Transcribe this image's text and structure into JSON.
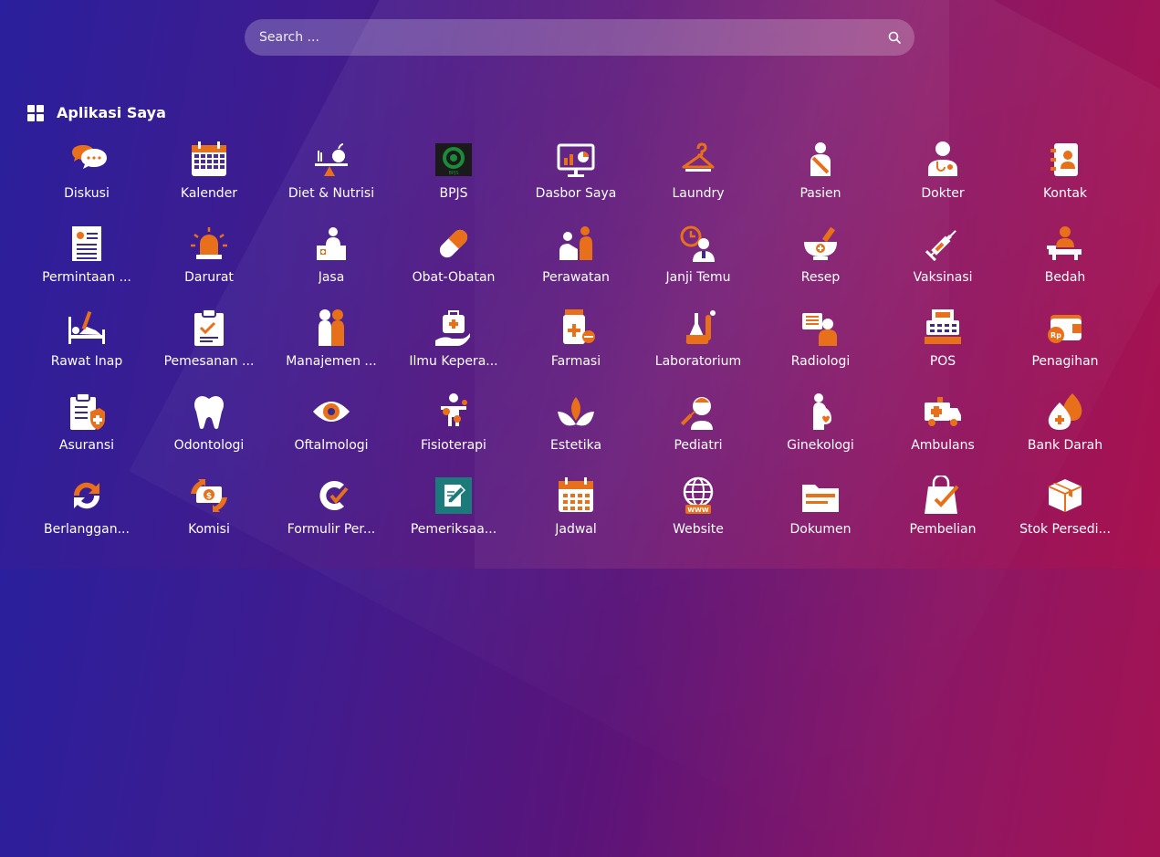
{
  "search": {
    "placeholder": "Search ..."
  },
  "section": {
    "title": "Aplikasi Saya",
    "icon": "grid-icon"
  },
  "colors": {
    "accent": "#e8701a",
    "icon_white": "#ffffff"
  },
  "apps": [
    {
      "label": "Diskusi",
      "icon": "chat-bubbles-icon"
    },
    {
      "label": "Kalender",
      "icon": "calendar-icon"
    },
    {
      "label": "Diet & Nutrisi",
      "icon": "scale-apple-icon"
    },
    {
      "label": "BPJS",
      "icon": "bpjs-logo-icon"
    },
    {
      "label": "Dasbor Saya",
      "icon": "dashboard-icon"
    },
    {
      "label": "Laundry",
      "icon": "hanger-icon"
    },
    {
      "label": "Pasien",
      "icon": "patient-icon"
    },
    {
      "label": "Dokter",
      "icon": "doctor-icon"
    },
    {
      "label": "Kontak",
      "icon": "contact-book-icon"
    },
    {
      "label": "Permintaan ...",
      "icon": "request-form-icon"
    },
    {
      "label": "Darurat",
      "icon": "siren-icon"
    },
    {
      "label": "Jasa",
      "icon": "service-desk-icon"
    },
    {
      "label": "Obat-Obatan",
      "icon": "capsule-icon"
    },
    {
      "label": "Perawatan",
      "icon": "care-icon"
    },
    {
      "label": "Janji Temu",
      "icon": "appointment-icon"
    },
    {
      "label": "Resep",
      "icon": "mortar-pestle-icon"
    },
    {
      "label": "Vaksinasi",
      "icon": "syringe-icon"
    },
    {
      "label": "Bedah",
      "icon": "surgery-icon"
    },
    {
      "label": "Rawat Inap",
      "icon": "hospital-bed-icon"
    },
    {
      "label": "Pemesanan ...",
      "icon": "clipboard-check-icon"
    },
    {
      "label": "Manajemen ...",
      "icon": "people-icon"
    },
    {
      "label": "Ilmu Kepera...",
      "icon": "medical-bag-hand-icon"
    },
    {
      "label": "Farmasi",
      "icon": "pill-bottle-icon"
    },
    {
      "label": "Laboratorium",
      "icon": "lab-flask-icon"
    },
    {
      "label": "Radiologi",
      "icon": "xray-icon"
    },
    {
      "label": "POS",
      "icon": "cash-register-icon"
    },
    {
      "label": "Penagihan",
      "icon": "wallet-rp-icon"
    },
    {
      "label": "Asuransi",
      "icon": "insurance-clipboard-icon"
    },
    {
      "label": "Odontologi",
      "icon": "tooth-icon"
    },
    {
      "label": "Oftalmologi",
      "icon": "eye-icon"
    },
    {
      "label": "Fisioterapi",
      "icon": "physio-icon"
    },
    {
      "label": "Estetika",
      "icon": "lotus-icon"
    },
    {
      "label": "Pediatri",
      "icon": "baby-syringe-icon"
    },
    {
      "label": "Ginekologi",
      "icon": "pregnant-icon"
    },
    {
      "label": "Ambulans",
      "icon": "ambulance-icon"
    },
    {
      "label": "Bank Darah",
      "icon": "blood-drop-icon"
    },
    {
      "label": "Berlanggan...",
      "icon": "subscription-arrows-icon"
    },
    {
      "label": "Komisi",
      "icon": "commission-icon"
    },
    {
      "label": "Formulir Per...",
      "icon": "form-c-icon"
    },
    {
      "label": "Pemeriksaa...",
      "icon": "examination-icon"
    },
    {
      "label": "Jadwal",
      "icon": "schedule-icon"
    },
    {
      "label": "Website",
      "icon": "globe-www-icon"
    },
    {
      "label": "Dokumen",
      "icon": "folder-icon"
    },
    {
      "label": "Pembelian",
      "icon": "shopping-bag-icon"
    },
    {
      "label": "Stok Persedi...",
      "icon": "box-icon"
    }
  ]
}
